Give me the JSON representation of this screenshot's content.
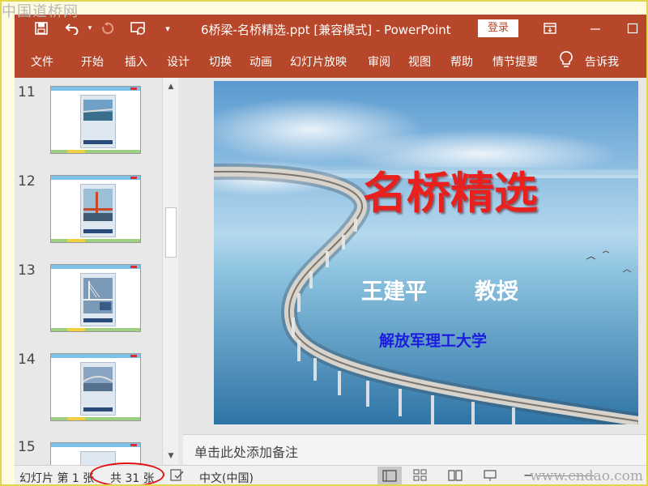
{
  "watermark": {
    "top": "中国道桥网",
    "bottom": "www.cndao.com"
  },
  "titlebar": {
    "title": "6桥梁-名桥精选.ppt [兼容模式]  -  PowerPoint",
    "login": "登录",
    "colors": {
      "accent": "#b7472a"
    },
    "icons": [
      "save-icon",
      "undo-icon",
      "redo-icon",
      "slideshow-start-icon",
      "customize-toolbar-icon",
      "ribbon-display-icon"
    ]
  },
  "menu": {
    "file": "文件",
    "home": "开始",
    "insert": "插入",
    "design": "设计",
    "transitions": "切换",
    "animations": "动画",
    "slideshow": "幻灯片放映",
    "review": "审阅",
    "view": "视图",
    "help": "帮助",
    "storyboard": "情节提要",
    "tellme": "告诉我"
  },
  "thumbnails": [
    {
      "number": "11"
    },
    {
      "number": "12"
    },
    {
      "number": "13"
    },
    {
      "number": "14"
    },
    {
      "number": "15"
    }
  ],
  "slide": {
    "title": "名桥精选",
    "author": "王建平",
    "rank": "教授",
    "school": "解放军理工大学",
    "colors": {
      "title": "#e8201e",
      "school": "#1c1ce0"
    }
  },
  "notes": {
    "placeholder": "单击此处添加备注"
  },
  "statusbar": {
    "slide_part1": "幻灯片 第 1 张",
    "slide_part2": "共 31 张",
    "language": "中文(中国)",
    "highlight_color": "#e01010"
  }
}
